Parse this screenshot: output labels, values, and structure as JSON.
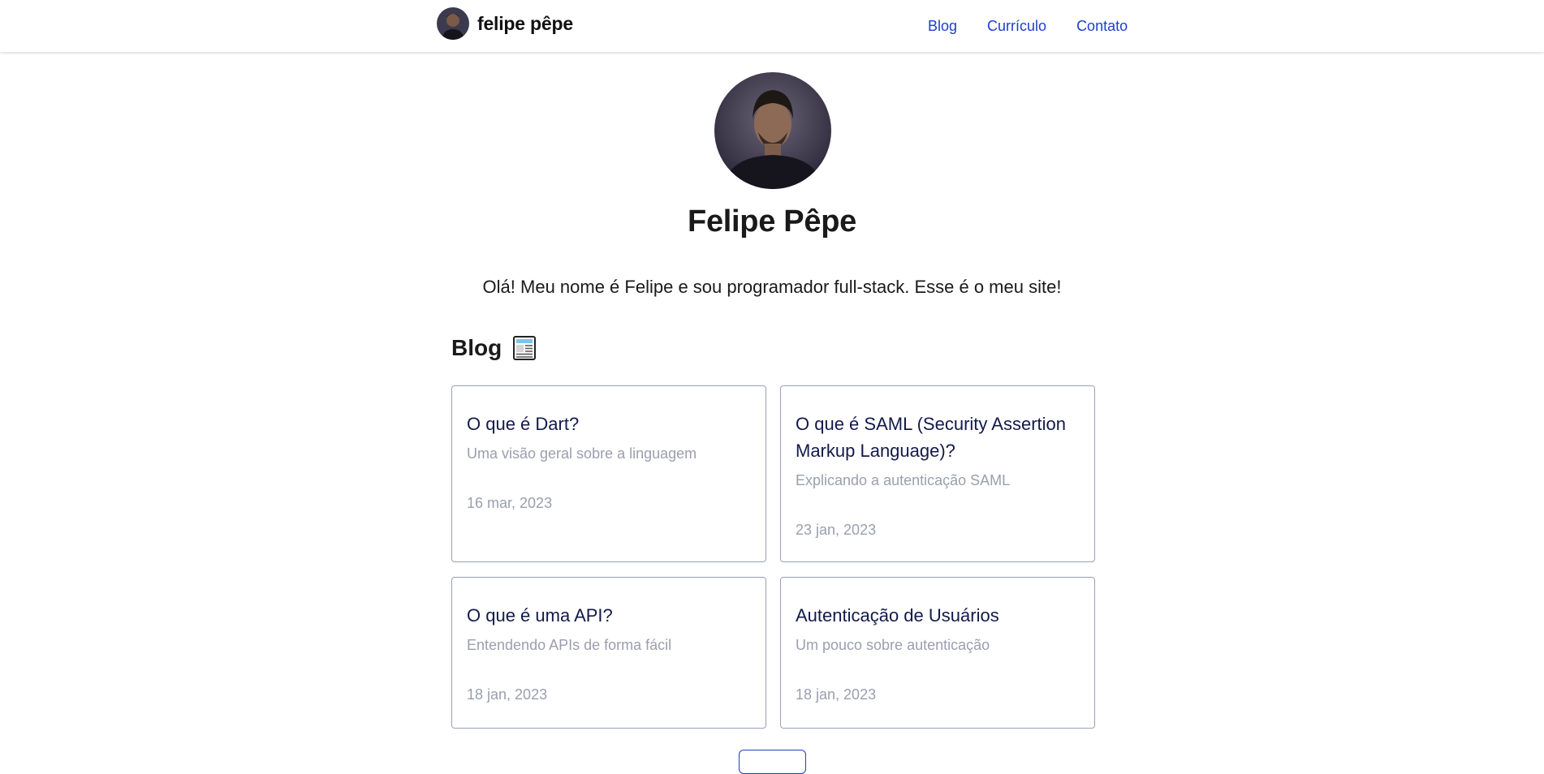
{
  "header": {
    "brand_name": "felipe pêpe",
    "nav": [
      "Blog",
      "Currículo",
      "Contato"
    ]
  },
  "hero": {
    "name": "Felipe Pêpe",
    "intro": "Olá! Meu nome é Felipe e sou programador full-stack. Esse é o meu site!"
  },
  "blog": {
    "title": "Blog",
    "icon": "newspaper-icon",
    "posts": [
      {
        "title": "O que é Dart?",
        "description": "Uma visão geral sobre a linguagem",
        "date": "16 mar, 2023"
      },
      {
        "title": "O que é SAML (Security Assertion Markup Language)?",
        "description": "Explicando a autenticação SAML",
        "date": "23 jan, 2023"
      },
      {
        "title": "O que é uma API?",
        "description": "Entendendo APIs de forma fácil",
        "date": "18 jan, 2023"
      },
      {
        "title": "Autenticação de Usuários",
        "description": "Um pouco sobre autenticação",
        "date": "18 jan, 2023"
      }
    ]
  },
  "colors": {
    "link": "#1e40c8",
    "card_title": "#131a4a",
    "muted": "#9b9eae",
    "card_border": "#9a9fb6"
  }
}
